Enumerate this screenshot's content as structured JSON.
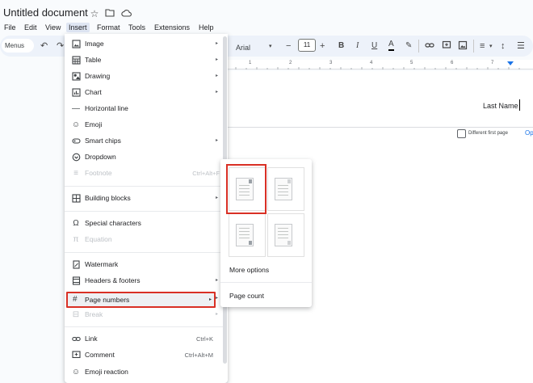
{
  "doc": {
    "title": "Untitled document"
  },
  "menubar": {
    "items": [
      {
        "name": "menu-file",
        "label": "File"
      },
      {
        "name": "menu-edit",
        "label": "Edit"
      },
      {
        "name": "menu-view",
        "label": "View"
      },
      {
        "name": "menu-insert",
        "label": "Insert"
      },
      {
        "name": "menu-format",
        "label": "Format"
      },
      {
        "name": "menu-tools",
        "label": "Tools"
      },
      {
        "name": "menu-extensions",
        "label": "Extensions"
      },
      {
        "name": "menu-help",
        "label": "Help"
      }
    ]
  },
  "toolbar": {
    "menus_label": "Menus",
    "font": "Arial",
    "font_size": "11"
  },
  "ruler": {
    "numbers": [
      "1",
      "2",
      "3",
      "4",
      "5",
      "6",
      "7"
    ]
  },
  "document": {
    "header_text": "Last Name",
    "different_first_page": "Different first page",
    "options_label": "Op"
  },
  "insert_menu": {
    "image": "Image",
    "table": "Table",
    "drawing": "Drawing",
    "chart": "Chart",
    "horizontal_line": "Horizontal line",
    "emoji": "Emoji",
    "smart_chips": "Smart chips",
    "dropdown": "Dropdown",
    "footnote": "Footnote",
    "footnote_shortcut": "Ctrl+Alt+F",
    "building_blocks": "Building blocks",
    "special_characters": "Special characters",
    "equation": "Equation",
    "watermark": "Watermark",
    "headers_footers": "Headers & footers",
    "page_numbers": "Page numbers",
    "break": "Break",
    "link": "Link",
    "link_shortcut": "Ctrl+K",
    "comment": "Comment",
    "comment_shortcut": "Ctrl+Alt+M",
    "emoji_reaction": "Emoji reaction"
  },
  "page_numbers_submenu": {
    "more_options": "More options",
    "page_count": "Page count"
  },
  "colors": {
    "highlight": "#d93025",
    "link_blue": "#1a73e8"
  }
}
